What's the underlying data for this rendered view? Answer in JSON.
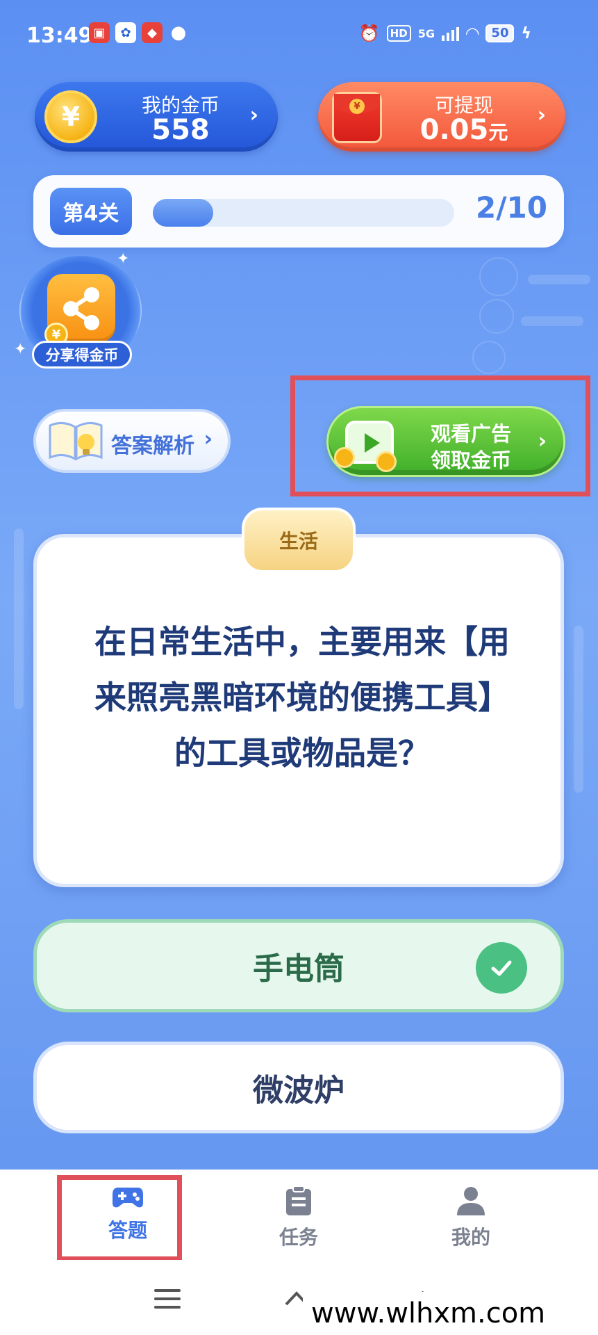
{
  "status_bar": {
    "time": "13:49",
    "network": "5G",
    "hd": "HD",
    "battery": "50"
  },
  "wallet": {
    "coins_label": "我的金币",
    "coins_value": "558",
    "cash_label": "可提现",
    "cash_value": "0.05",
    "cash_unit": "元"
  },
  "level": {
    "badge": "第4关",
    "progress_text": "2/10",
    "progress_fraction": 0.2
  },
  "share": {
    "label": "分享得金币"
  },
  "analysis": {
    "label": "答案解析"
  },
  "ad": {
    "line1": "观看广告",
    "line2": "领取金币"
  },
  "question": {
    "category": "生活",
    "text": "在日常生活中，主要用来【用来照亮黑暗环境的便携工具】的工具或物品是？"
  },
  "options": [
    {
      "label": "手电筒",
      "correct": true
    },
    {
      "label": "微波炉",
      "correct": false
    }
  ],
  "nav": {
    "items": [
      {
        "label": "答题",
        "icon": "gamepad-icon",
        "active": true
      },
      {
        "label": "任务",
        "icon": "clipboard-icon",
        "active": false
      },
      {
        "label": "我的",
        "icon": "user-icon",
        "active": false
      }
    ]
  },
  "watermark": "www.wlhxm.com",
  "colors": {
    "accent_blue": "#3f73e6",
    "highlight_red": "#e0505a",
    "correct_green": "#4bc083"
  }
}
